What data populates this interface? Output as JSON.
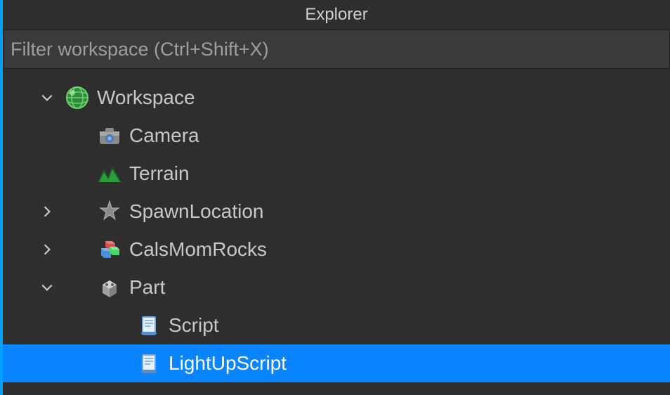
{
  "panel": {
    "title": "Explorer",
    "filter_placeholder": "Filter workspace (Ctrl+Shift+X)"
  },
  "tree": {
    "workspace": {
      "label": "Workspace",
      "camera": {
        "label": "Camera"
      },
      "terrain": {
        "label": "Terrain"
      },
      "spawn": {
        "label": "SpawnLocation"
      },
      "model": {
        "label": "CalsMomRocks"
      },
      "part": {
        "label": "Part",
        "script1": {
          "label": "Script"
        },
        "script2": {
          "label": "LightUpScript"
        }
      }
    }
  }
}
